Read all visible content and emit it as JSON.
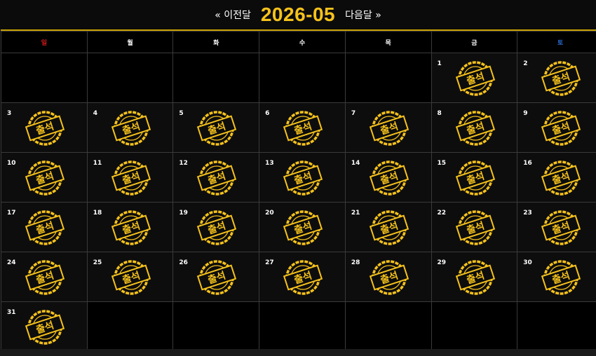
{
  "header": {
    "prev_label": "« 이전달",
    "month": "2026-05",
    "next_label": "다음달 »"
  },
  "weekdays": [
    {
      "label": "일",
      "kind": "sun"
    },
    {
      "label": "월",
      "kind": "normal"
    },
    {
      "label": "화",
      "kind": "normal"
    },
    {
      "label": "수",
      "kind": "normal"
    },
    {
      "label": "목",
      "kind": "normal"
    },
    {
      "label": "금",
      "kind": "normal"
    },
    {
      "label": "토",
      "kind": "sat"
    }
  ],
  "weeks": [
    [
      null,
      null,
      null,
      null,
      null,
      1,
      2
    ],
    [
      3,
      4,
      5,
      6,
      7,
      8,
      9
    ],
    [
      10,
      11,
      12,
      13,
      14,
      15,
      16
    ],
    [
      17,
      18,
      19,
      20,
      21,
      22,
      23
    ],
    [
      24,
      25,
      26,
      27,
      28,
      29,
      30
    ],
    [
      31,
      null,
      null,
      null,
      null,
      null,
      null
    ]
  ],
  "stamp": {
    "text": "출석",
    "color": "#f6c21b"
  }
}
